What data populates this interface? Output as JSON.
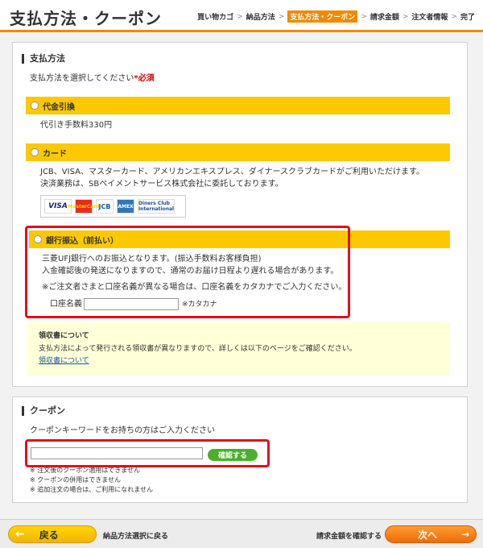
{
  "header": {
    "title": "支払方法・クーポン",
    "steps": [
      "買い物カゴ",
      "納品方法",
      "支払方法・クーポン",
      "請求金額",
      "注文者情報",
      "完了"
    ],
    "step_sep": ">"
  },
  "payment": {
    "heading": "支払方法",
    "instruction": "支払方法を選択してください",
    "required": "*必須",
    "cod": {
      "label": "代金引換",
      "fee": "代引き手数料330円"
    },
    "card": {
      "label": "カード",
      "desc1": "JCB、VISA、マスターカード、アメリカンエキスプレス、ダイナースクラブカードがご利用いただけます。",
      "desc2": "決済業務は、SBペイメントサービス株式会社に委託しております。",
      "logos": [
        "VISA",
        "MasterCard",
        "JCB",
        "AMEX",
        "Diners Club International"
      ]
    },
    "bank": {
      "label": "銀行振込（前払い）",
      "desc1": "三菱UFJ銀行へのお振込となります。(振込手数料お客様負担)",
      "desc2": "入金確認後の発送になりますので、通常のお届け日程より遅れる場合があります。",
      "desc3": "※ご注文者さまと口座名義が異なる場合は、口座名義をカタカナでご入力ください。",
      "account_label": "口座名義",
      "account_value": "",
      "account_note": "※カタカナ"
    },
    "receipt": {
      "heading": "領収書について",
      "desc": "支払方法によって発行される領収書が異なりますので、詳しくは以下のページをご確認ください。",
      "link": "領収書について"
    }
  },
  "coupon": {
    "heading": "クーポン",
    "instruction": "クーポンキーワードをお持ちの方はご入力ください",
    "input_value": "",
    "confirm_label": "確認する",
    "notes": [
      "※ 注文後のクーポン適用はできません",
      "※ クーポンの併用はできません",
      "※ 追加注文の場合は、ご利用になれません"
    ]
  },
  "footer": {
    "back_label": "戻る",
    "back_desc": "納品方法選択に戻る",
    "next_desc": "請求金額を確認する",
    "next_label": "次へ"
  },
  "colors": {
    "accent": "#f08a00",
    "bar": "#fcc800",
    "highlight": "#e0101e",
    "confirm": "#4caf2c"
  }
}
